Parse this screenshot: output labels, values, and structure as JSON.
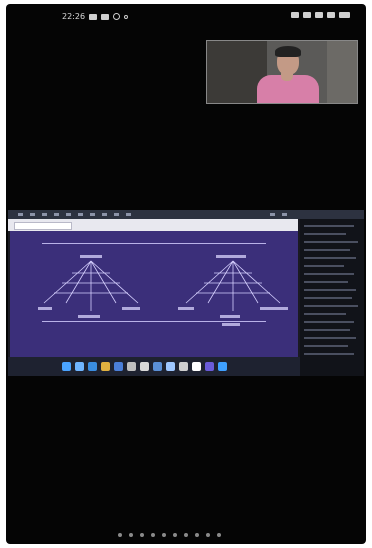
{
  "status_bar": {
    "time": "22:26",
    "icons_left": [
      "notification-icon",
      "message-icon",
      "media-icon"
    ],
    "icons_right": [
      "mute-icon",
      "wifi-icon",
      "signal-icon",
      "battery-icon"
    ]
  },
  "video_tile": {
    "participant": "presenter-camera"
  },
  "shared_screen": {
    "slide": {
      "left_diagram_title": "",
      "right_diagram_title": "",
      "left_labels": [
        "",
        "",
        ""
      ],
      "right_labels": [
        "",
        "",
        ""
      ]
    },
    "taskbar_icons": [
      {
        "name": "start-icon",
        "color": "#4aa3ff"
      },
      {
        "name": "search-icon",
        "color": "#6fb5ff"
      },
      {
        "name": "browser-icon",
        "color": "#3a8de0"
      },
      {
        "name": "files-icon",
        "color": "#e0b040"
      },
      {
        "name": "mail-icon",
        "color": "#4b7fd8"
      },
      {
        "name": "app-icon-1",
        "color": "#bfbfbf"
      },
      {
        "name": "app-icon-2",
        "color": "#d9d9d9"
      },
      {
        "name": "app-icon-3",
        "color": "#5a8fd6"
      },
      {
        "name": "app-icon-4",
        "color": "#9ec7ff"
      },
      {
        "name": "app-icon-5",
        "color": "#cfcfcf"
      },
      {
        "name": "app-icon-6",
        "color": "#ffffff"
      },
      {
        "name": "app-icon-7",
        "color": "#6a5bd8"
      },
      {
        "name": "app-icon-8",
        "color": "#3fa0ff"
      }
    ]
  },
  "nav": {
    "dots": 10
  }
}
